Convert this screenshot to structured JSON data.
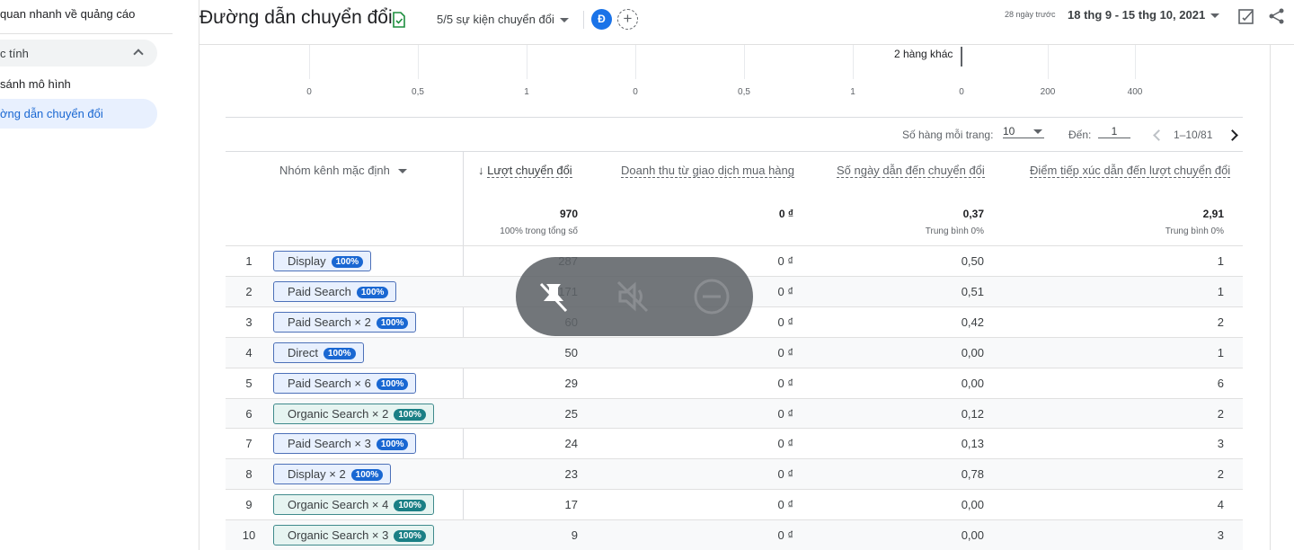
{
  "sidebar": {
    "items": [
      {
        "label": "quan nhanh về quảng cáo"
      },
      {
        "label": "c tính"
      },
      {
        "label": "sánh mô hình"
      },
      {
        "label": "ờng dẫn chuyển đổi"
      }
    ]
  },
  "header": {
    "title": "Đường dẫn chuyển đổi",
    "events": "5/5 sự kiện chuyển đổi",
    "avatar": "Đ",
    "plus": "+",
    "ago": "28 ngày trước",
    "date_range": "18 thg 9 - 15 thg 10, 2021"
  },
  "axis": {
    "ticks": [
      "0",
      "0,5",
      "1",
      "0",
      "0,5",
      "1",
      "0",
      "200",
      "400"
    ],
    "other_rows": "2 hàng khác"
  },
  "pager": {
    "rows_label": "Số hàng mỗi trang:",
    "rows_value": "10",
    "goto_label": "Đến:",
    "goto_value": "1",
    "range": "1–10/81"
  },
  "table": {
    "headers": {
      "dimension": "Nhóm kênh mặc định",
      "conversions": "Lượt chuyển đổi",
      "revenue": "Doanh thu từ giao dịch mua hàng",
      "days": "Số ngày dẫn đến chuyển đổi",
      "touchpoints": "Điểm tiếp xúc dẫn đến lượt chuyển đổi"
    },
    "totals": {
      "conversions": "970",
      "conversions_sub": "100% trong tổng số",
      "revenue": "0 ₫",
      "days": "0,37",
      "days_sub": "Trung bình 0%",
      "touchpoints": "2,91",
      "touchpoints_sub": "Trung bình 0%"
    },
    "badge": "100%",
    "rows": [
      {
        "n": "1",
        "channel": "Display",
        "conv": "287",
        "rev": "0 ₫",
        "days": "0,50",
        "tp": "1"
      },
      {
        "n": "2",
        "channel": "Paid Search",
        "conv": "171",
        "rev": "0 ₫",
        "days": "0,51",
        "tp": "1"
      },
      {
        "n": "3",
        "channel": "Paid Search × 2",
        "conv": "60",
        "rev": "0 ₫",
        "days": "0,42",
        "tp": "2"
      },
      {
        "n": "4",
        "channel": "Direct",
        "conv": "50",
        "rev": "0 ₫",
        "days": "0,00",
        "tp": "1"
      },
      {
        "n": "5",
        "channel": "Paid Search × 6",
        "conv": "29",
        "rev": "0 ₫",
        "days": "0,00",
        "tp": "6"
      },
      {
        "n": "6",
        "channel": "Organic Search × 2",
        "conv": "25",
        "rev": "0 ₫",
        "days": "0,12",
        "tp": "2"
      },
      {
        "n": "7",
        "channel": "Paid Search × 3",
        "conv": "24",
        "rev": "0 ₫",
        "days": "0,13",
        "tp": "3"
      },
      {
        "n": "8",
        "channel": "Display × 2",
        "conv": "23",
        "rev": "0 ₫",
        "days": "0,78",
        "tp": "2"
      },
      {
        "n": "9",
        "channel": "Organic Search × 4",
        "conv": "17",
        "rev": "0 ₫",
        "days": "0,00",
        "tp": "4"
      },
      {
        "n": "10",
        "channel": "Organic Search × 3",
        "conv": "9",
        "rev": "0 ₫",
        "days": "0,00",
        "tp": "3"
      }
    ]
  },
  "overlay": {
    "icons": [
      "unpin-icon",
      "mute-icon",
      "minus-circle-icon"
    ]
  }
}
